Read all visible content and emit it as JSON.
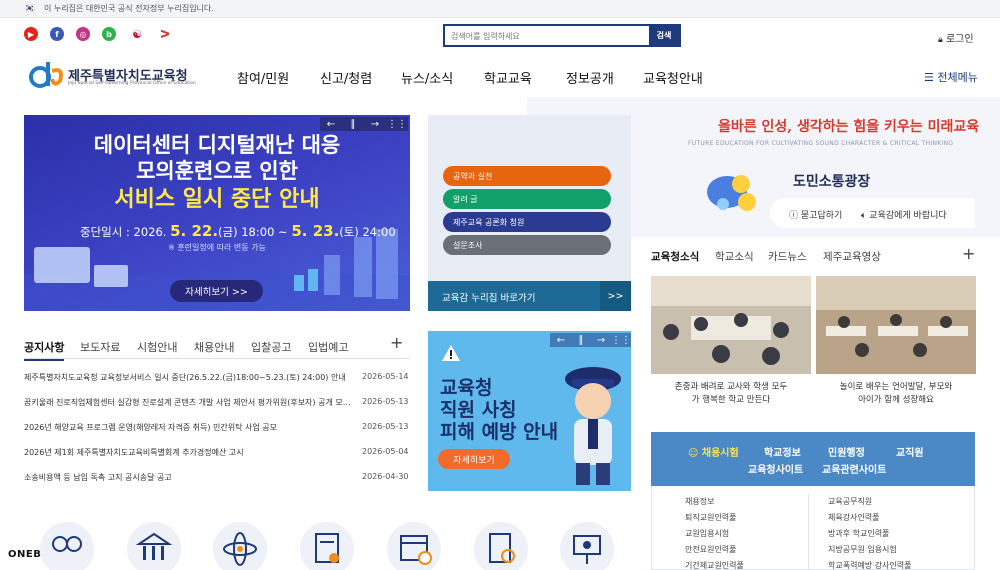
{
  "topbar": {
    "flag": "🇰🇷",
    "notice": "이 누리집은 대한민국 공식 전자정부 누리집입니다."
  },
  "social": [
    {
      "icon": "youtube-icon",
      "glyph": "▶",
      "color": "#e62117"
    },
    {
      "icon": "facebook-icon",
      "glyph": "f",
      "color": "#3b5bb3"
    },
    {
      "icon": "instagram-icon",
      "glyph": "◎",
      "color": "#c13584"
    },
    {
      "icon": "blog-icon",
      "glyph": "b",
      "color": "#2cb34a"
    },
    {
      "icon": "taegeuk-icon",
      "glyph": "☯",
      "color": "#ffffff"
    },
    {
      "icon": "app-icon",
      "glyph": "ᐳ",
      "color": "#ffffff"
    }
  ],
  "search": {
    "placeholder": "검색어를 입력하세요",
    "button": "검색"
  },
  "header": {
    "login": "로그인",
    "logo_title": "제주특별자치도교육청",
    "logo_sub": "Jeju Special Self-Governing Provincial Office of Education",
    "nav": [
      "참여/민원",
      "신고/청렴",
      "뉴스/소식",
      "학교교육",
      "정보공개",
      "교육청안내"
    ],
    "all_menu": "전체메뉴"
  },
  "banner": {
    "line1": "데이터센터 디지털재난 대응",
    "line2": "모의훈련으로 인한",
    "line3": "서비스 일시 중단 안내",
    "date_label": "중단일시 : 2026.",
    "date_d1": "5. 22.",
    "date_t1": "(금) 18:00 ~",
    "date_d2": "5. 23.",
    "date_t2": "(토) 24:00",
    "note": "※ 훈련일정에 따라 변동 가능",
    "button": "자세히보기 >>"
  },
  "mid_links": {
    "pills": [
      {
        "label": "공약과 실천",
        "color": "#e8650f"
      },
      {
        "label": "알려 글",
        "color": "#12a06a"
      },
      {
        "label": "제주교육 공론화 청원",
        "color": "#2c3b92"
      },
      {
        "label": "설문조사",
        "color": "#6b6f78"
      }
    ],
    "bar": "교육감 누리집 바로가기",
    "bar_arrow": ">>"
  },
  "notice": {
    "tabs": [
      "공지사항",
      "보도자료",
      "시험안내",
      "채용안내",
      "입찰공고",
      "입법예고"
    ],
    "rows": [
      {
        "title": "제주특별자치도교육청 교육정보서비스 일시 중단(26.5.22.(금)18:00~5.23.(토) 24:00) 안내",
        "date": "2026-05-14"
      },
      {
        "title": "꿈키울래 진로직업체험센터 실감형 진로설계 콘텐츠 개발 사업 제안서 평가위원(후보자) 공개 모집 ...",
        "date": "2026-05-13"
      },
      {
        "title": "2026년 해양교육 프로그램 운영(해양레저 자격증 취득) 민간위탁 사업 공모",
        "date": "2026-05-13"
      },
      {
        "title": "2026년 제1회 제주특별자치도교육비특별회계 추가경정예산 고시",
        "date": "2026-05-04"
      },
      {
        "title": "소송비용액 등 납입 독촉 고지 공시송달 공고",
        "date": "2026-04-30"
      }
    ]
  },
  "poster": {
    "line1": "교육청",
    "line2": "직원 사칭",
    "line3": "피해 예방 안내",
    "button": "자세히보기"
  },
  "slogan": {
    "text": "올바른 인성, 생각하는 힘을 키우는 미래교육",
    "sub": "FUTURE EDUCATION FOR CULTIVATING SOUND CHARACTER & CRITICAL THINKING"
  },
  "plaza": {
    "title": "도민소통광장",
    "ask": "묻고답하기",
    "wish": "교육감에게 바랍니다"
  },
  "news": {
    "tabs": [
      "교육청소식",
      "학교소식",
      "카드뉴스",
      "제주교육영상"
    ],
    "items": [
      {
        "cap1": "존중과 배려로 교사와 학생 모두",
        "cap2": "가 행복한 학교 만든다"
      },
      {
        "cap1": "놀이로 배우는 언어발달, 부모와",
        "cap2": "아이가 함께 성장해요"
      }
    ]
  },
  "jobs": {
    "tabs": [
      "채용시험",
      "학교정보",
      "민원행정",
      "교직원",
      "교육청사이트",
      "교육관련사이트"
    ],
    "col1": [
      "채용정보",
      "퇴직교원인력풀",
      "교원임용시험",
      "안전요원인력풀",
      "기간제교원인력풀"
    ],
    "col2": [
      "교육공무직원",
      "체육강사인력풀",
      "방과후 학교인력풀",
      "지방공무원 임용시험",
      "학교폭력예방 강사인력풀"
    ]
  },
  "bottom": {
    "brand": "ONEBIT",
    "icons": [
      "people-icon",
      "institution-icon",
      "science-icon",
      "certificate-icon",
      "calendar-icon",
      "document-search-icon",
      "presentation-icon"
    ]
  }
}
